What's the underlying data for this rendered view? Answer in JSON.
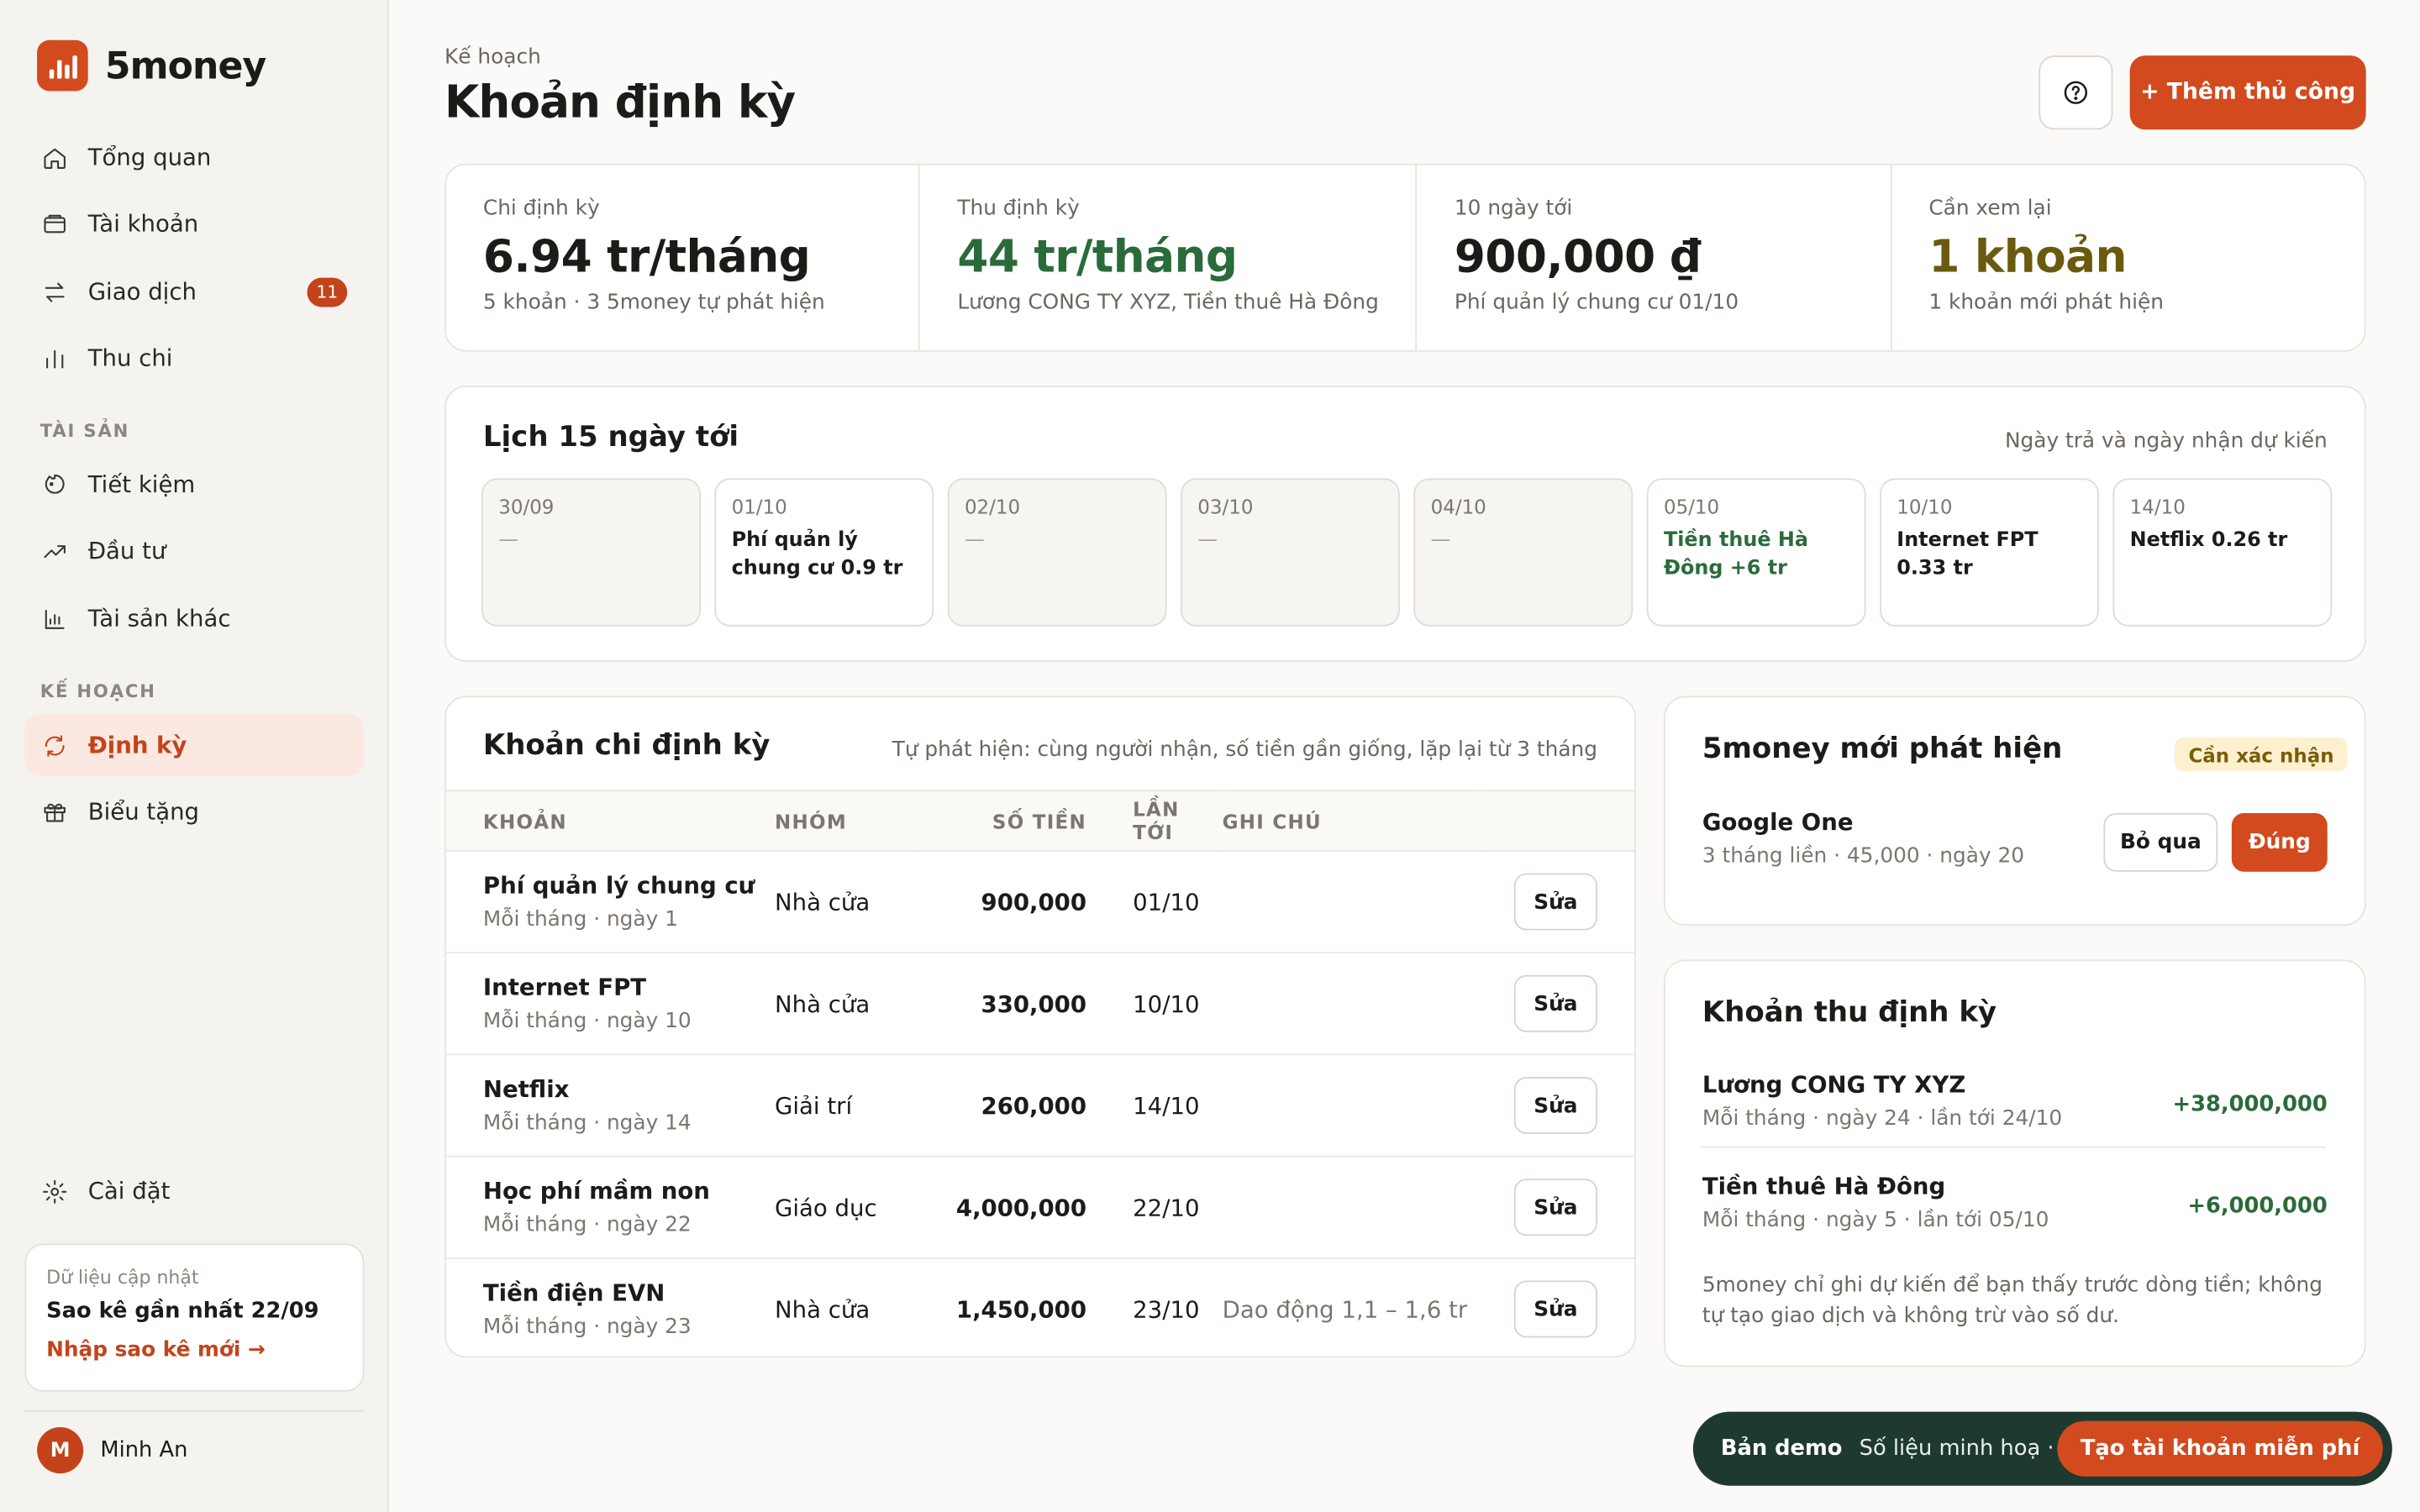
{
  "app": {
    "name": "5money"
  },
  "sidebar": {
    "nav": [
      {
        "label": "Tổng quan",
        "icon": "home-icon"
      },
      {
        "label": "Tài khoản",
        "icon": "wallet-icon"
      },
      {
        "label": "Giao dịch",
        "icon": "transfer-icon",
        "badge": "11"
      },
      {
        "label": "Thu chi",
        "icon": "bar-chart-icon"
      }
    ],
    "section_assets": "TÀI SẢN",
    "assets": [
      {
        "label": "Tiết kiệm",
        "icon": "piggy-bank-icon"
      },
      {
        "label": "Đầu tư",
        "icon": "trend-up-icon"
      },
      {
        "label": "Tài sản khác",
        "icon": "chart-icon"
      }
    ],
    "section_plan": "KẾ HOẠCH",
    "plan": [
      {
        "label": "Định kỳ",
        "icon": "recurring-icon",
        "active": true
      },
      {
        "label": "Biểu tặng",
        "icon": "gift-icon"
      }
    ],
    "settings": {
      "label": "Cài đặt",
      "icon": "gear-icon"
    },
    "update": {
      "caption": "Dữ liệu cập nhật",
      "title": "Sao kê gần nhất 22/09",
      "link": "Nhập sao kê mới →"
    },
    "user": {
      "initial": "M",
      "name": "Minh An"
    }
  },
  "header": {
    "breadcrumb": "Kế hoạch",
    "title": "Khoản định kỳ",
    "add_label": "+ Thêm thủ công"
  },
  "stats": [
    {
      "label": "Chi định kỳ",
      "value": "6.94 tr/tháng",
      "sub": "5 khoản · 3 5money tự phát hiện",
      "tone": "default"
    },
    {
      "label": "Thu định kỳ",
      "value": "44 tr/tháng",
      "sub": "Lương CONG TY XYZ, Tiền thuê Hà Đông",
      "tone": "green"
    },
    {
      "label": "10 ngày tới",
      "value": "900,000 ₫",
      "sub": "Phí quản lý chung cư 01/10",
      "tone": "default"
    },
    {
      "label": "Cần xem lại",
      "value": "1 khoản",
      "sub": "1 khoản mới phát hiện",
      "tone": "olive"
    }
  ],
  "calendar": {
    "title": "Lịch 15 ngày tới",
    "note": "Ngày trả và ngày nhận dự kiến",
    "days": [
      {
        "date": "30/09",
        "event": "—",
        "kind": "empty"
      },
      {
        "date": "01/10",
        "event": "Phí quản lý chung cư 0.9 tr",
        "kind": "expense"
      },
      {
        "date": "02/10",
        "event": "—",
        "kind": "empty"
      },
      {
        "date": "03/10",
        "event": "—",
        "kind": "empty"
      },
      {
        "date": "04/10",
        "event": "—",
        "kind": "empty"
      },
      {
        "date": "05/10",
        "event": "Tiền thuê Hà Đông +6 tr",
        "kind": "income"
      },
      {
        "date": "10/10",
        "event": "Internet FPT 0.33 tr",
        "kind": "expense"
      },
      {
        "date": "14/10",
        "event": "Netflix 0.26 tr",
        "kind": "expense"
      }
    ]
  },
  "expenses": {
    "title": "Khoản chi định kỳ",
    "note": "Tự phát hiện: cùng người nhận, số tiền gần giống, lặp lại từ 3 tháng",
    "columns": [
      "KHOẢN",
      "NHÓM",
      "SỐ TIỀN",
      "LẦN TỚI",
      "GHI CHÚ"
    ],
    "edit_label": "Sửa",
    "rows": [
      {
        "name": "Phí quản lý chung cư",
        "schedule": "Mỗi tháng · ngày 1",
        "group": "Nhà cửa",
        "amount": "900,000",
        "next": "01/10",
        "note": ""
      },
      {
        "name": "Internet FPT",
        "schedule": "Mỗi tháng · ngày 10",
        "group": "Nhà cửa",
        "amount": "330,000",
        "next": "10/10",
        "note": ""
      },
      {
        "name": "Netflix",
        "schedule": "Mỗi tháng · ngày 14",
        "group": "Giải trí",
        "amount": "260,000",
        "next": "14/10",
        "note": ""
      },
      {
        "name": "Học phí mầm non",
        "schedule": "Mỗi tháng · ngày 22",
        "group": "Giáo dục",
        "amount": "4,000,000",
        "next": "22/10",
        "note": ""
      },
      {
        "name": "Tiền điện EVN",
        "schedule": "Mỗi tháng · ngày 23",
        "group": "Nhà cửa",
        "amount": "1,450,000",
        "next": "23/10",
        "note": "Dao động 1,1 – 1,6 tr"
      }
    ]
  },
  "detected": {
    "title": "5money mới phát hiện",
    "badge": "Cần xác nhận",
    "item": {
      "name": "Google One",
      "meta": "3 tháng liền · 45,000 · ngày 20"
    },
    "dismiss_label": "Bỏ qua",
    "confirm_label": "Đúng"
  },
  "income": {
    "title": "Khoản thu định kỳ",
    "rows": [
      {
        "name": "Lương CONG TY XYZ",
        "meta": "Mỗi tháng · ngày 24 · lần tới 24/10",
        "amount": "+38,000,000"
      },
      {
        "name": "Tiền thuê Hà Đông",
        "meta": "Mỗi tháng · ngày 5 · lần tới 05/10",
        "amount": "+6,000,000"
      }
    ],
    "disclaimer": "5money chỉ ghi dự kiến để bạn thấy trước dòng tiền; không tự tạo giao dịch và không trừ vào số dư."
  },
  "demo_bar": {
    "label": "Bản demo",
    "text": "Số liệu minh hoạ · chỉ xem",
    "cta": "Tạo tài khoản miễn phí"
  },
  "colors": {
    "accent": "#d24a1e",
    "income": "#2a6b3a",
    "warning": "#6b5a0e",
    "demo_bg": "#1e3a30"
  }
}
